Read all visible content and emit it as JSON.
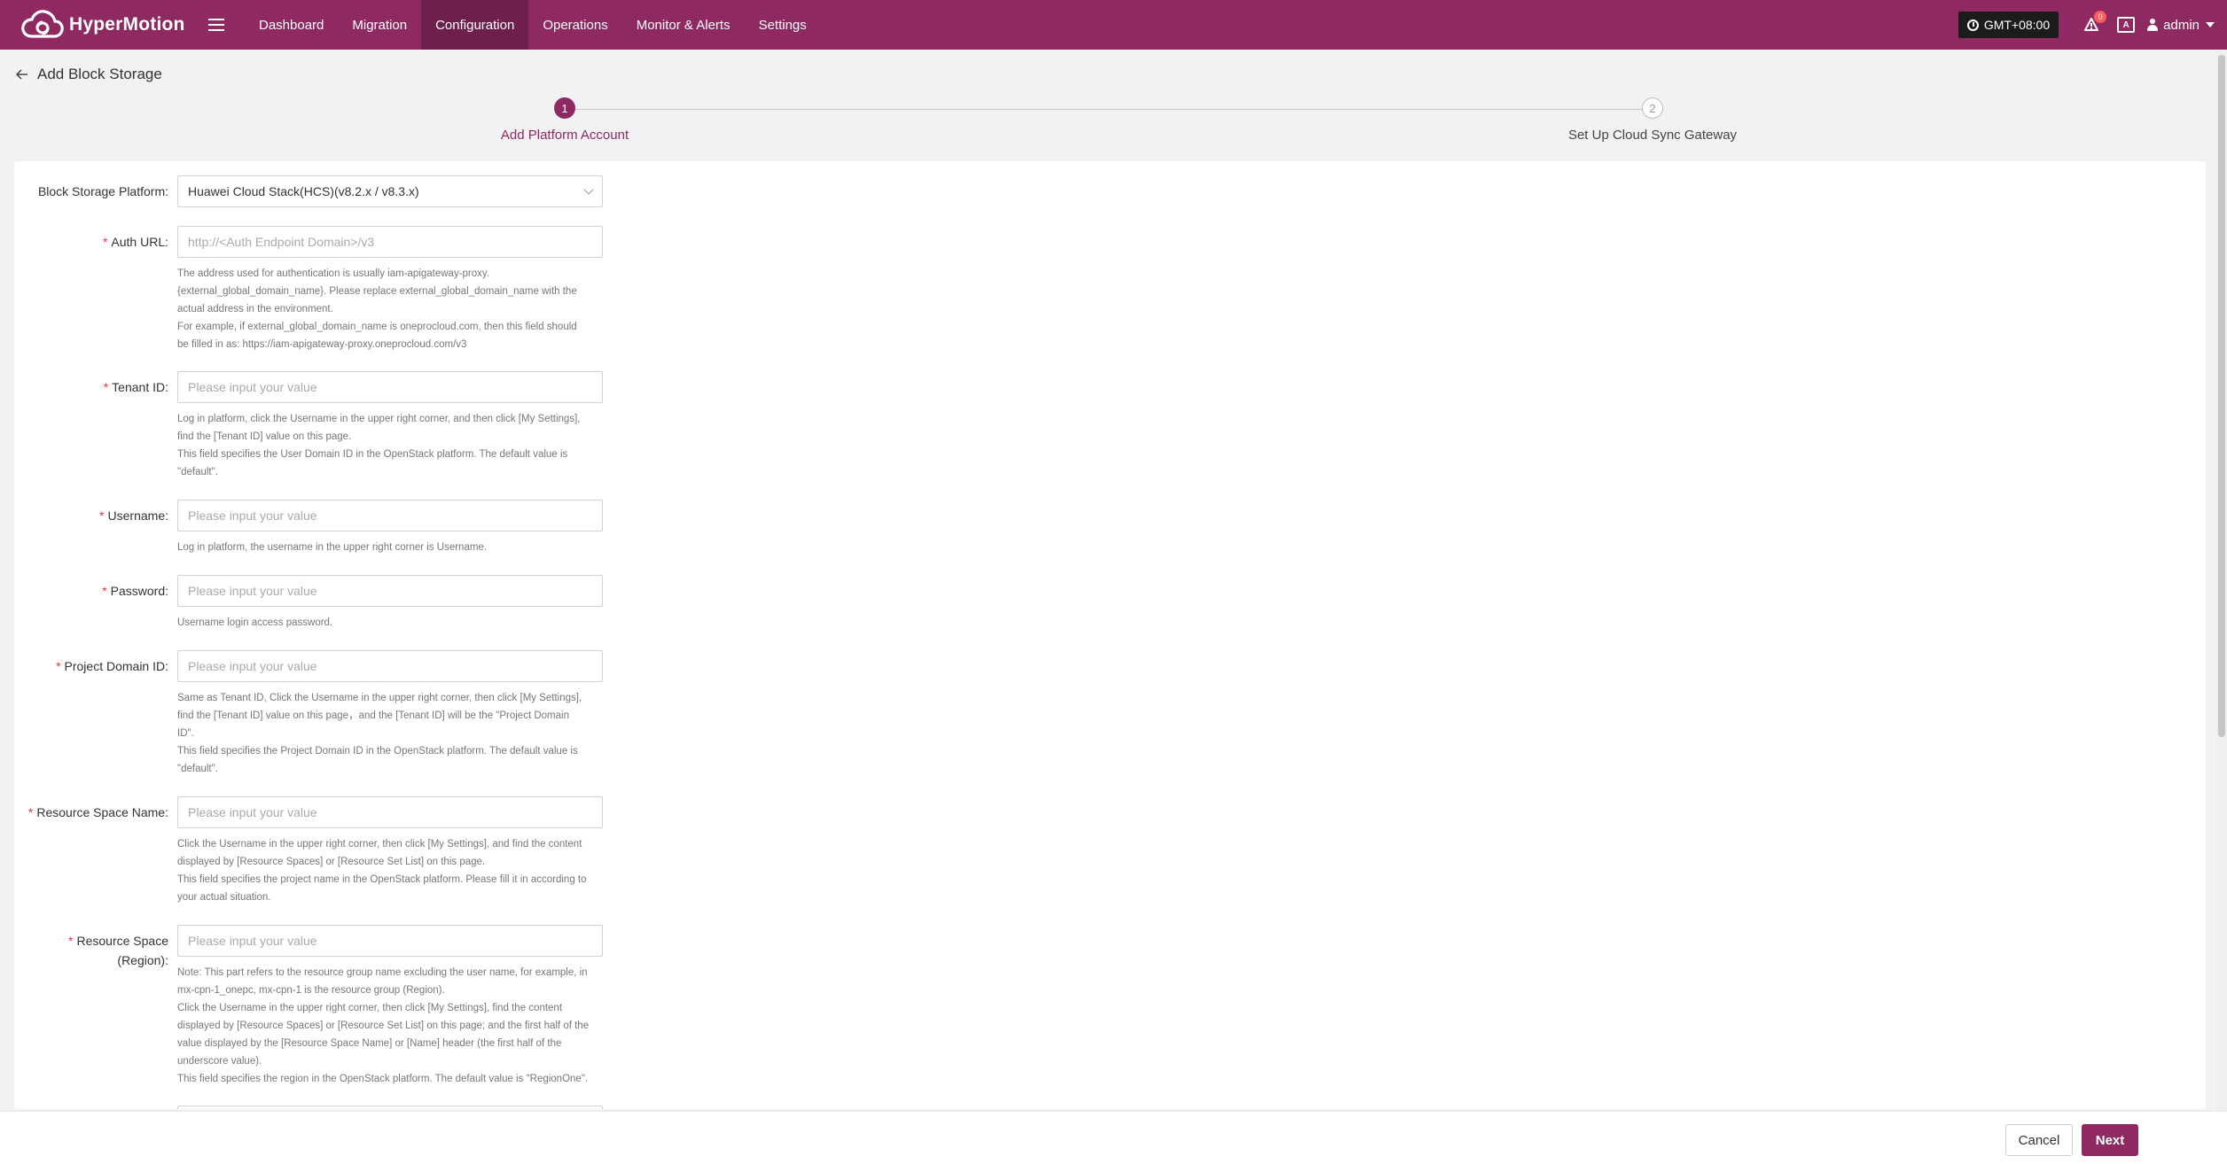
{
  "app": {
    "name": "HyperMotion",
    "brand_color": "#8e2a61"
  },
  "nav": {
    "items": [
      {
        "label": "Dashboard",
        "active": false
      },
      {
        "label": "Migration",
        "active": false
      },
      {
        "label": "Configuration",
        "active": true
      },
      {
        "label": "Operations",
        "active": false
      },
      {
        "label": "Monitor & Alerts",
        "active": false
      },
      {
        "label": "Settings",
        "active": false
      }
    ],
    "timezone": "GMT+08:00",
    "notification_count": "0",
    "lang_icon": "A",
    "user": "admin"
  },
  "page": {
    "title": "Add Block Storage"
  },
  "steps": [
    {
      "number": "1",
      "label": "Add Platform Account",
      "state": "active"
    },
    {
      "number": "2",
      "label": "Set Up Cloud Sync Gateway",
      "state": "pending"
    }
  ],
  "form": {
    "platform": {
      "label": "Block Storage Platform:",
      "value": "Huawei Cloud Stack(HCS)(v8.2.x / v8.3.x)"
    },
    "auth_url": {
      "label": "Auth URL:",
      "placeholder": "http://<Auth Endpoint Domain>/v3",
      "help": [
        "The address used for authentication is usually iam-apigateway-proxy.",
        "{external_global_domain_name}. Please replace external_global_domain_name with the",
        "actual address in the environment.",
        "For example, if external_global_domain_name is oneprocloud.com, then this field should",
        "be filled in as: https://iam-apigateway-proxy.oneprocloud.com/v3"
      ]
    },
    "tenant_id": {
      "label": "Tenant ID:",
      "placeholder": "Please input your value",
      "help": [
        "Log in platform, click the Username in the upper right corner, and then click [My Settings],",
        "find the [Tenant ID] value on this page.",
        "This field specifies the User Domain ID in the OpenStack platform. The default value is",
        "\"default\"."
      ]
    },
    "username": {
      "label": "Username:",
      "placeholder": "Please input your value",
      "help": [
        "Log in platform, the username in the upper right corner is Username."
      ]
    },
    "password": {
      "label": "Password:",
      "placeholder": "Please input your value",
      "help": [
        "Username login access password."
      ]
    },
    "project_domain_id": {
      "label": "Project Domain ID:",
      "placeholder": "Please input your value",
      "help": [
        "Same as Tenant ID, Click the Username in the upper right corner, then click [My Settings],",
        "find the [Tenant ID] value on this page，and the [Tenant ID] will be the \"Project Domain",
        "ID\".",
        "This field specifies the Project Domain ID in the OpenStack platform. The default value is",
        "\"default\"."
      ]
    },
    "resource_space_name": {
      "label": "Resource Space Name:",
      "placeholder": "Please input your value",
      "help": [
        "Click the Username in the upper right corner, then click [My Settings], and find the content",
        "displayed by [Resource Spaces] or [Resource Set List] on this page.",
        "This field specifies the project name in the OpenStack platform. Please fill it in according to",
        "your actual situation."
      ]
    },
    "resource_space_region": {
      "label_line1": "Resource Space",
      "label_line2": "(Region):",
      "placeholder": "Please input your value",
      "help": [
        "Note: This part refers to the resource group name excluding the user name, for example, in",
        "mx-cpn-1_onepc, mx-cpn-1 is the resource group (Region).",
        "Click the Username in the upper right corner, then click [My Settings], find the content",
        "displayed by [Resource Spaces] or [Resource Set List] on this page; and the first half of the",
        "value displayed by the [Resource Space Name] or [Name] header (the first half of the",
        "underscore value).",
        "This field specifies the region in the OpenStack platform. The default value is \"RegionOne\"."
      ]
    }
  },
  "footer": {
    "cancel_label": "Cancel",
    "next_label": "Next"
  }
}
